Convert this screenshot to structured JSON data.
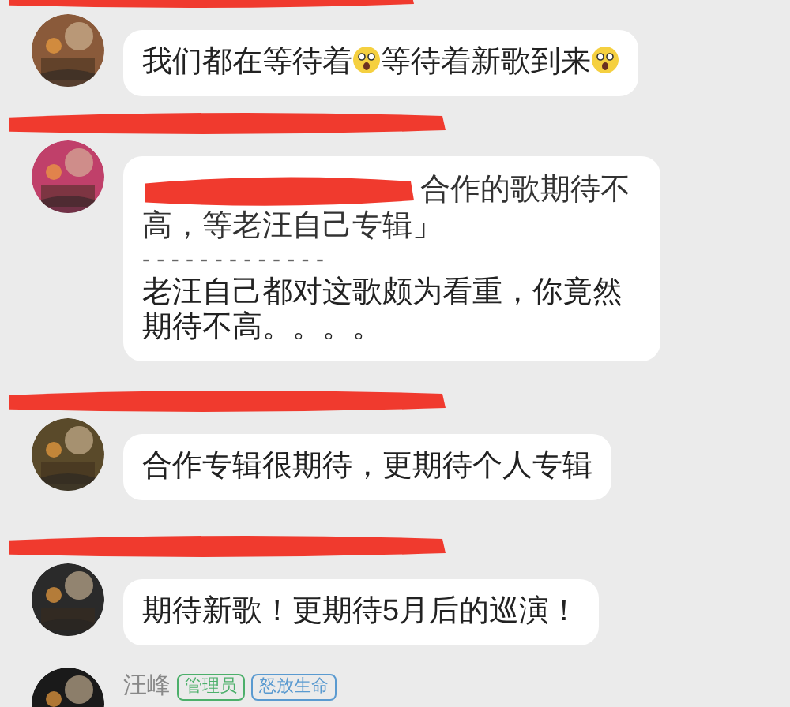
{
  "messages": [
    {
      "kind": "redacted",
      "avatar": {
        "kind": "picture"
      },
      "parts": [
        {
          "kind": "text",
          "text": "我们都在等待着"
        },
        {
          "kind": "emoji"
        },
        {
          "kind": "text",
          "text": "等待着新歌到来"
        },
        {
          "kind": "emoji"
        }
      ]
    },
    {
      "kind": "redacted",
      "avatar": {
        "kind": "picture"
      },
      "quote": [
        "合作的歌期待不",
        "高，等老汪自己专辑」"
      ],
      "divider": "- - - - - - - - - - - - -",
      "parts": [
        {
          "kind": "text",
          "text": "老汪自己都对这歌颇为看重，你竟然期待不高。。。。"
        }
      ]
    },
    {
      "kind": "redacted",
      "avatar": {
        "kind": "picture"
      },
      "parts": [
        {
          "kind": "text",
          "text": "合作专辑很期待，更期待个人专辑"
        }
      ]
    },
    {
      "kind": "redacted",
      "avatar": {
        "kind": "picture"
      },
      "parts": [
        {
          "kind": "text",
          "text": "期待新歌！更期待5月后的巡演！"
        }
      ]
    },
    {
      "kind": "named",
      "avatar": {
        "kind": "picture"
      },
      "name": "汪峰",
      "badges": [
        {
          "text": "管理员",
          "color": "#4caf6a"
        },
        {
          "text": "怒放生命",
          "color": "#5a9ad0"
        }
      ]
    }
  ]
}
